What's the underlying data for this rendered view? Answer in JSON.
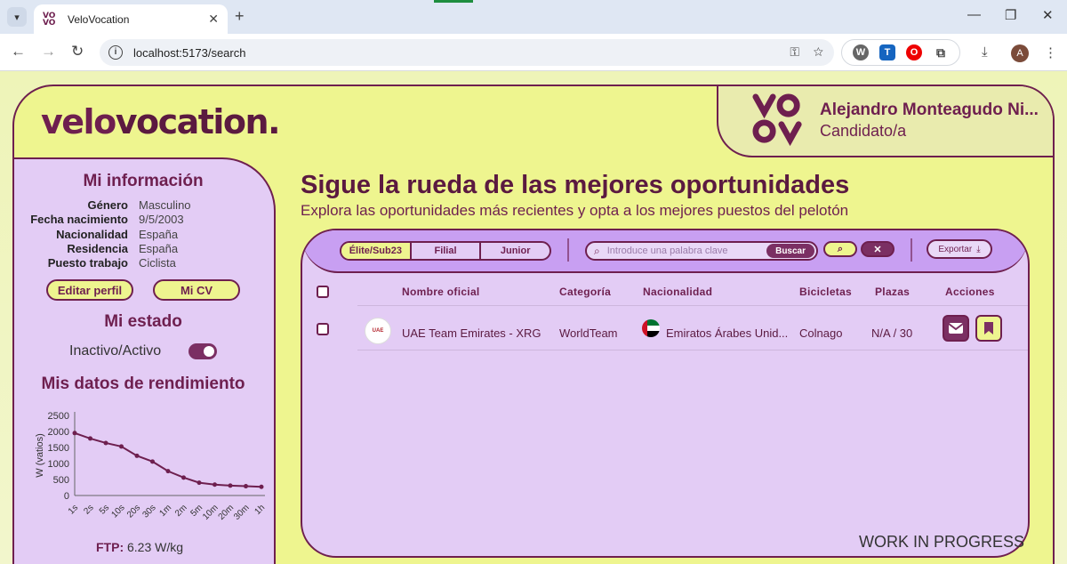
{
  "browser": {
    "tab_title": "VeloVocation",
    "tab_favicon_text": "VO VO",
    "url": "localhost:5173/search",
    "avatar_initial": "A",
    "extensions": [
      "W",
      "T",
      "O"
    ]
  },
  "header": {
    "logo_part1": "velo",
    "logo_part2": "vocation.",
    "user_name": "Alejandro Monteagudo Ni...",
    "user_role": "Candidato/a",
    "brand_mark": "VO\nVO"
  },
  "sidebar": {
    "info_title": "Mi información",
    "info": [
      {
        "label": "Género",
        "value": "Masculino"
      },
      {
        "label": "Fecha nacimiento",
        "value": "9/5/2003"
      },
      {
        "label": "Nacionalidad",
        "value": "España"
      },
      {
        "label": "Residencia",
        "value": "España"
      },
      {
        "label": "Puesto trabajo",
        "value": "Ciclista"
      }
    ],
    "edit_profile_label": "Editar perfil",
    "cv_label": "Mi CV",
    "status_title": "Mi estado",
    "status_label": "Inactivo/Activo",
    "status_active": true,
    "performance_title": "Mis datos de rendimiento",
    "ftp_label": "FTP:",
    "ftp_value": "6.23 W/kg"
  },
  "chart_data": {
    "type": "line",
    "ylabel": "W (vatios)",
    "categories": [
      "1s",
      "2s",
      "5s",
      "10s",
      "20s",
      "30s",
      "1m",
      "2m",
      "5m",
      "10m",
      "20m",
      "30m",
      "1h"
    ],
    "values": [
      1950,
      1780,
      1640,
      1530,
      1240,
      1060,
      760,
      560,
      400,
      340,
      310,
      290,
      270
    ],
    "ylim": [
      0,
      2500
    ],
    "yticks": [
      0,
      500,
      1000,
      1500,
      2000,
      2500
    ]
  },
  "main": {
    "headline": "Sigue la rueda de las mejores oportunidades",
    "subline": "Explora las oportunidades más recientes y opta a los mejores puestos del pelotón",
    "tabs": [
      "Élite/Sub23",
      "Filial",
      "Junior"
    ],
    "active_tab": "Élite/Sub23",
    "search_placeholder": "Introduce una palabra clave",
    "search_button": "Buscar",
    "export_label": "Exportar",
    "columns": [
      "Nombre oficial",
      "Categoría",
      "Nacionalidad",
      "Bicicletas",
      "Plazas",
      "Acciones"
    ],
    "rows": [
      {
        "logo_text": "UAE",
        "name": "UAE Team Emirates - XRG",
        "category": "WorldTeam",
        "nationality": "Emiratos Árabes Unid...",
        "bikes": "Colnago",
        "slots": "N/A / 30"
      }
    ]
  },
  "watermark": "WORK IN PROGRESS",
  "colors": {
    "brand": "#6e1f4f",
    "yellow": "#eef58f",
    "lilac": "#e3ccf5",
    "purple": "#c89ff2"
  }
}
